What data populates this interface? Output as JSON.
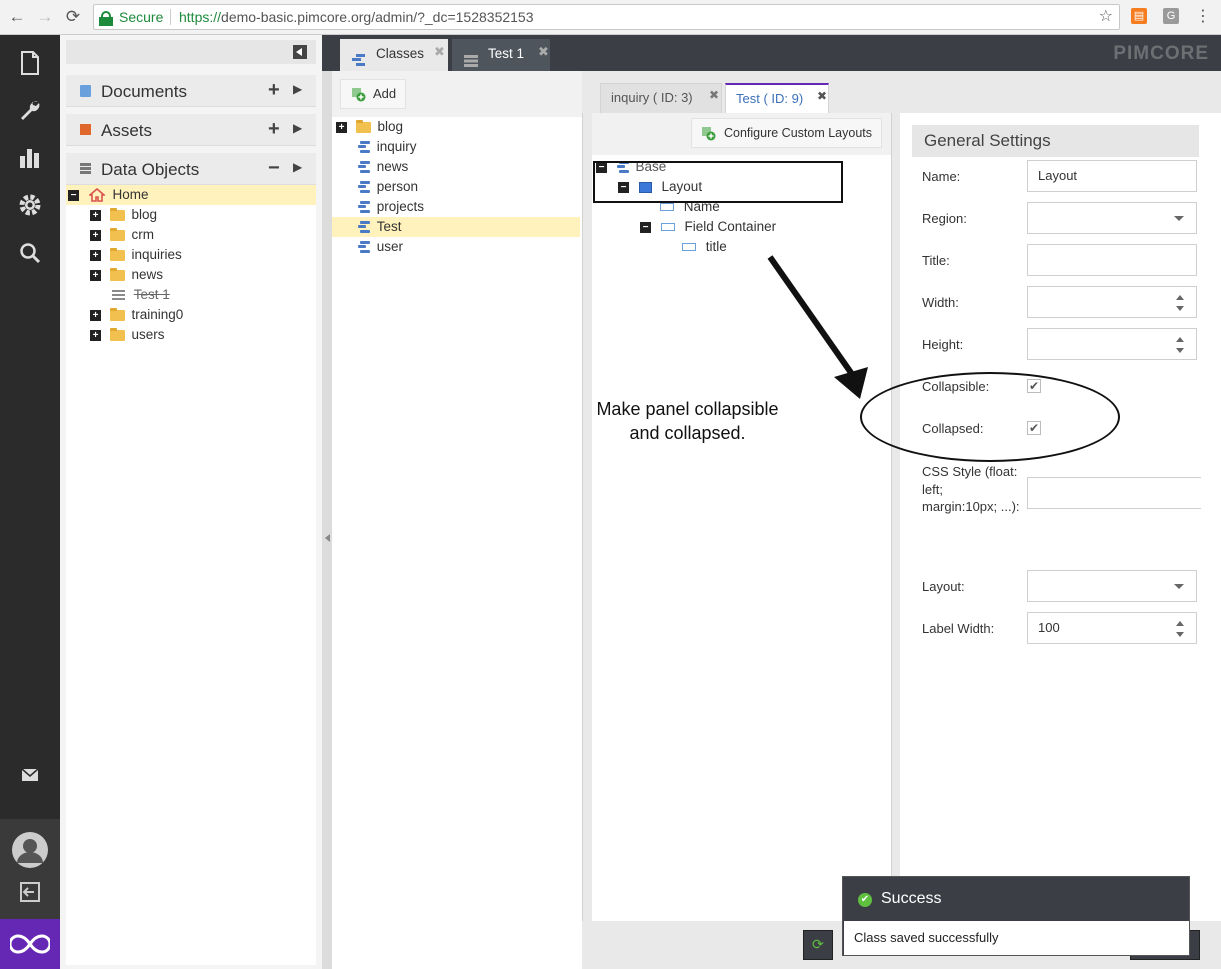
{
  "browser": {
    "secure_label": "Secure",
    "url_prefix": "https://",
    "url_host": "demo-basic.pimcore.org",
    "url_path": "/admin/?_dc=1528352153"
  },
  "nav": {
    "accordion": [
      {
        "label": "Documents",
        "icon": "document-icon",
        "action": "+"
      },
      {
        "label": "Assets",
        "icon": "image-icon",
        "action": "+"
      },
      {
        "label": "Data Objects",
        "icon": "database-icon",
        "action": "−"
      }
    ],
    "tree": [
      {
        "label": "Home",
        "expander": "−",
        "selected": true
      },
      {
        "label": "blog",
        "expander": "+"
      },
      {
        "label": "crm",
        "expander": "+"
      },
      {
        "label": "inquiries",
        "expander": "+"
      },
      {
        "label": "news",
        "expander": "+"
      },
      {
        "label": "Test 1",
        "expander": "",
        "struck": true
      },
      {
        "label": "training0",
        "expander": "+"
      },
      {
        "label": "users",
        "expander": "+"
      }
    ]
  },
  "tabs": [
    {
      "label": "Classes",
      "close": "✖"
    },
    {
      "label": "Test 1",
      "close": "✖"
    }
  ],
  "brand": "PIMCORE",
  "classes_panel": {
    "add_label": "Add",
    "items": [
      {
        "label": "blog",
        "type": "folder",
        "expander": "+"
      },
      {
        "label": "inquiry",
        "type": "class"
      },
      {
        "label": "news",
        "type": "class"
      },
      {
        "label": "person",
        "type": "class"
      },
      {
        "label": "projects",
        "type": "class"
      },
      {
        "label": "Test",
        "type": "class",
        "selected": true
      },
      {
        "label": "user",
        "type": "class"
      }
    ]
  },
  "editor": {
    "subtabs": [
      {
        "label": "inquiry ( ID: 3)",
        "close": "✖"
      },
      {
        "label": "Test ( ID: 9)",
        "close": "✖",
        "active": true
      }
    ],
    "configure_label": "Configure Custom Layouts",
    "layout_tree": [
      {
        "label": "Base",
        "expander": "−"
      },
      {
        "label": "Layout",
        "expander": "−"
      },
      {
        "label": "Name",
        "expander": ""
      },
      {
        "label": "Field Container",
        "expander": "−"
      },
      {
        "label": "title",
        "expander": ""
      }
    ],
    "annotation": "Make panel collapsible\nand collapsed.",
    "settings": {
      "header": "General Settings",
      "name_label": "Name:",
      "name_value": "Layout",
      "region_label": "Region:",
      "title_label": "Title:",
      "width_label": "Width:",
      "height_label": "Height:",
      "collapsible_label": "Collapsible:",
      "collapsible_checked": true,
      "collapsed_label": "Collapsed:",
      "collapsed_checked": true,
      "css_label": "CSS Style (float: left; margin:10px; ...):",
      "layout_label": "Layout:",
      "labelwidth_label": "Label Width:",
      "labelwidth_value": "100",
      "check_glyph": "✔"
    }
  },
  "toast": {
    "title": "Success",
    "message": "Class saved successfully"
  },
  "colors": {
    "accent": "#6428b4",
    "rail": "#2b2b2b",
    "selected_row": "#fff2bc",
    "tabbar": "#3b3f45"
  }
}
